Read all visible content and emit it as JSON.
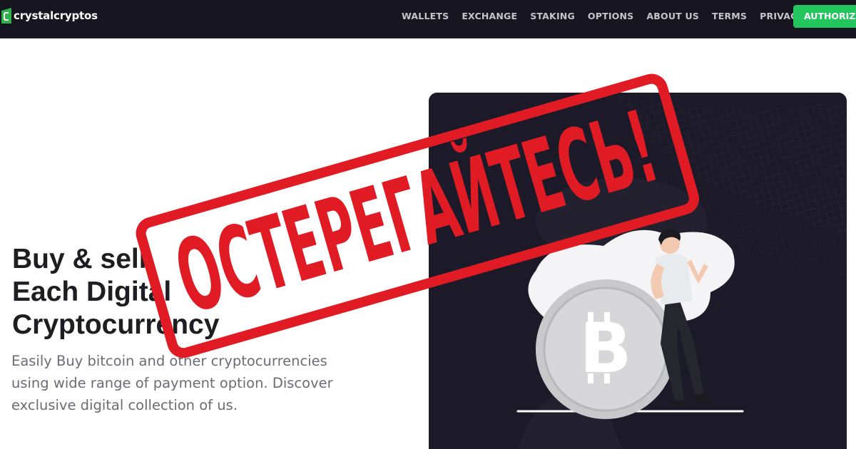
{
  "header": {
    "brand": "crystalcryptos",
    "nav_items": [
      "WALLETS",
      "EXCHANGE",
      "STAKING",
      "OPTIONS",
      "ABOUT US",
      "TERMS",
      "PRIVACY"
    ],
    "cta_label": "AUTHORIZE",
    "colors": {
      "background": "#17151f",
      "cta": "#22c55e",
      "logo": "#2fb24a"
    }
  },
  "hero": {
    "title_lines": [
      "Buy & sell",
      "Each Digital",
      "Cryptocurrency"
    ],
    "description_lines": [
      "Easily Buy bitcoin and other cryptocurrencies",
      "using wide range of payment option. Discover",
      "exclusive digital collection of us."
    ]
  },
  "illustration": {
    "coin_symbol": "B",
    "icons": [
      "bitcoin-coin-icon",
      "person-illustration"
    ]
  },
  "stamp": {
    "text": "ОСТЕРЕГАЙТЕСЬ!",
    "color": "#e01b24"
  }
}
